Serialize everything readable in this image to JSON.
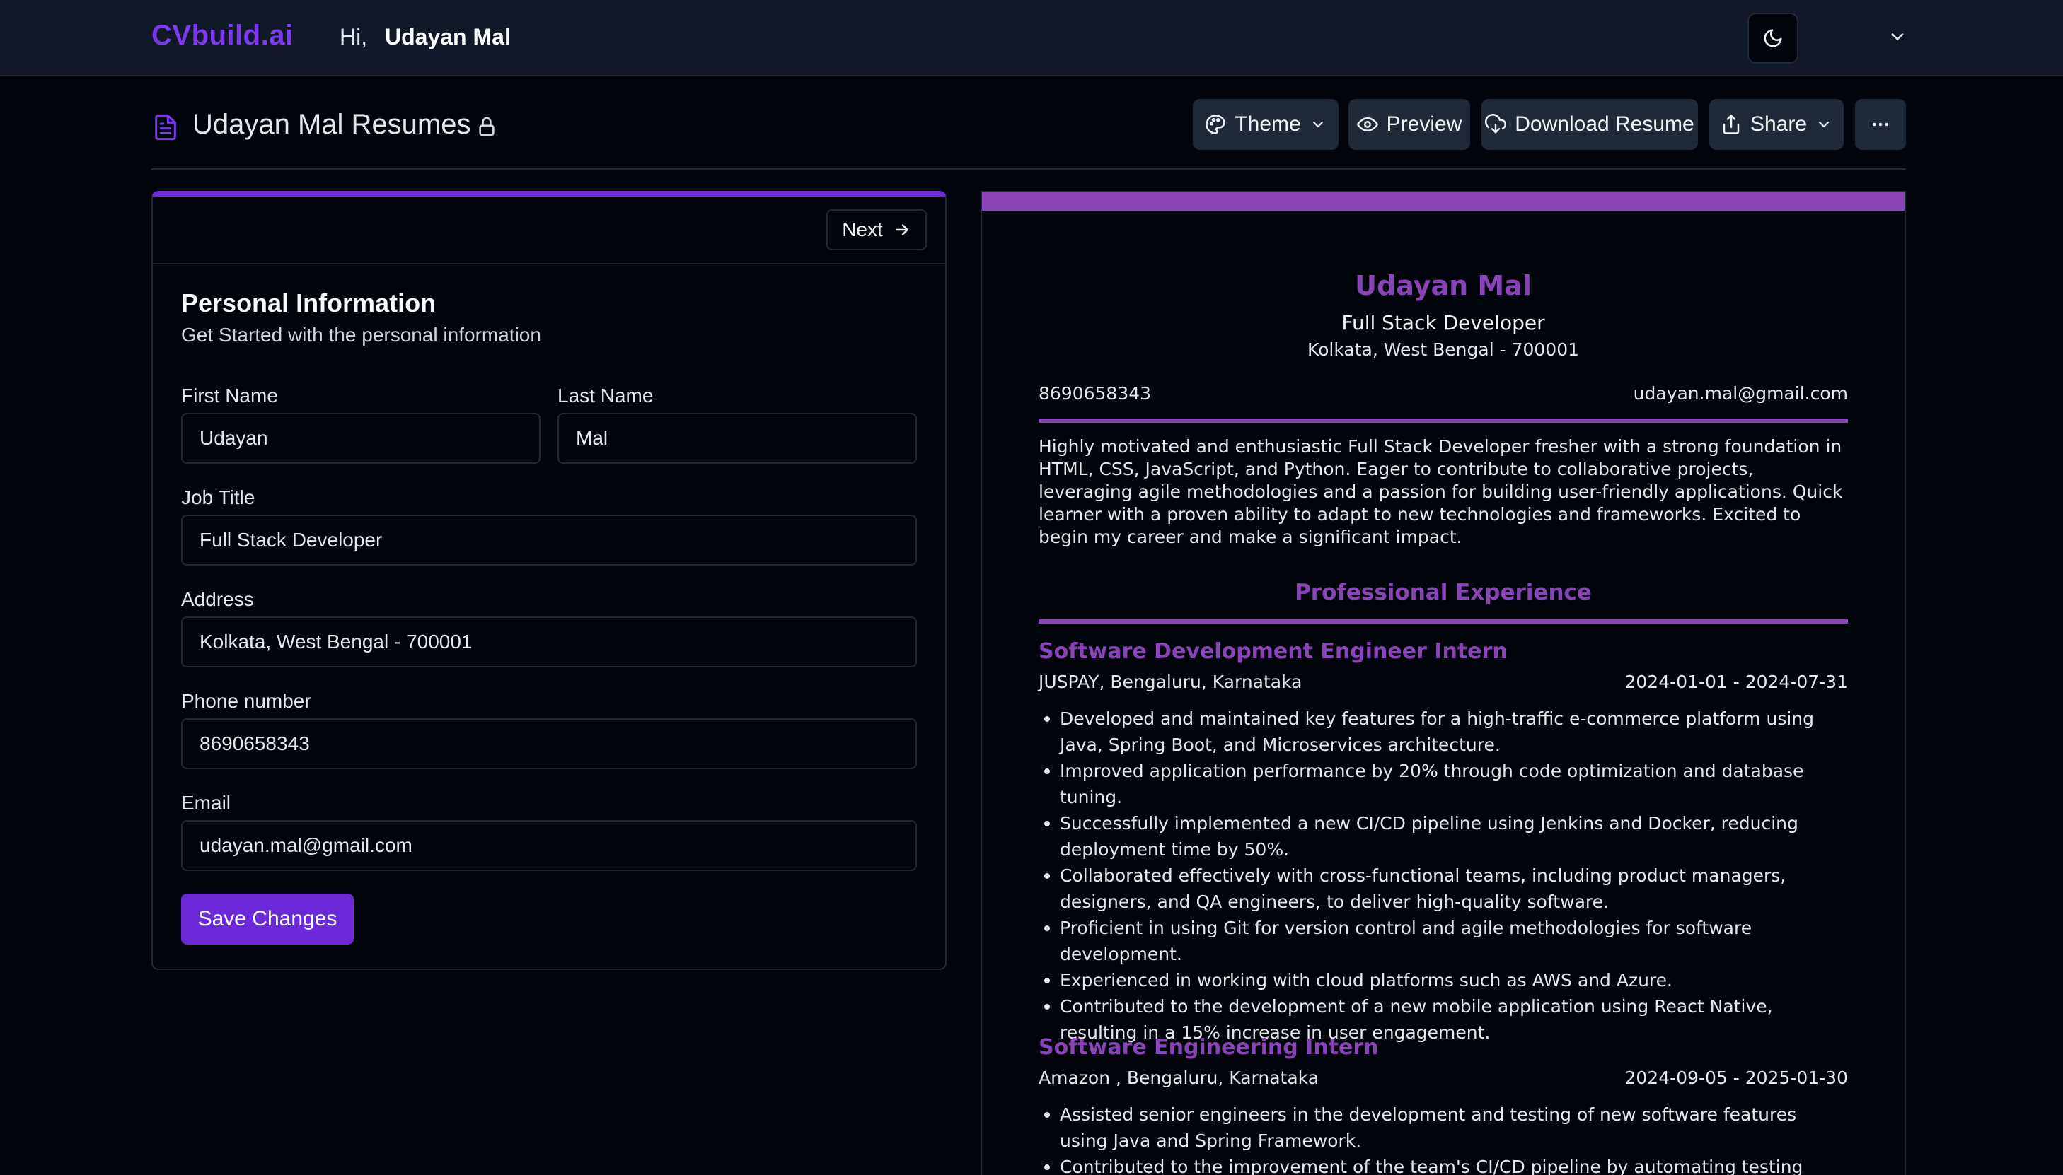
{
  "nav": {
    "brand": "CVbuild.ai",
    "greeting": "Hi,",
    "user_name": "Udayan Mal"
  },
  "header": {
    "title": "Udayan Mal Resumes",
    "theme_label": "Theme",
    "preview_label": "Preview",
    "download_label": "Download Resume",
    "share_label": "Share"
  },
  "form": {
    "next_label": "Next",
    "section_title": "Personal Information",
    "section_subtitle": "Get Started with the personal information",
    "first_name_label": "First Name",
    "first_name_value": "Udayan",
    "last_name_label": "Last Name",
    "last_name_value": "Mal",
    "job_title_label": "Job Title",
    "job_title_value": "Full Stack Developer",
    "address_label": "Address",
    "address_value": "Kolkata, West Bengal - 700001",
    "phone_label": "Phone number",
    "phone_value": "8690658343",
    "email_label": "Email",
    "email_value": "udayan.mal@gmail.com",
    "save_label": "Save Changes"
  },
  "resume": {
    "name": "Udayan Mal",
    "title": "Full Stack Developer",
    "address": "Kolkata, West Bengal - 700001",
    "phone": "8690658343",
    "email": "udayan.mal@gmail.com",
    "summary": "Highly motivated and enthusiastic Full Stack Developer fresher with a strong foundation in HTML, CSS, JavaScript, and Python. Eager to contribute to collaborative projects, leveraging agile methodologies and a passion for building user-friendly applications. Quick learner with a proven ability to adapt to new technologies and frameworks. Excited to begin my career and make a significant impact.",
    "experience_heading": "Professional Experience",
    "jobs": [
      {
        "title": "Software Development Engineer Intern",
        "company": "JUSPAY, Bengaluru, Karnataka",
        "dates": "2024-01-01 - 2024-07-31",
        "bullets": [
          "Developed and maintained key features for a high-traffic e-commerce platform using Java, Spring Boot, and Microservices architecture.",
          "Improved application performance by 20% through code optimization and database tuning.",
          "Successfully implemented a new CI/CD pipeline using Jenkins and Docker, reducing deployment time by 50%.",
          "Collaborated effectively with cross-functional teams, including product managers, designers, and QA engineers, to deliver high-quality software.",
          "Proficient in using Git for version control and agile methodologies for software development.",
          "Experienced in working with cloud platforms such as AWS and Azure.",
          "Contributed to the development of a new mobile application using React Native, resulting in a 15% increase in user engagement."
        ]
      },
      {
        "title": "Software Engineering Intern",
        "company": "Amazon , Bengaluru, Karnataka",
        "dates": "2024-09-05 - 2025-01-30",
        "bullets": [
          "Assisted senior engineers in the development and testing of new software features using Java and Spring Framework.",
          "Contributed to the improvement of the team's CI/CD pipeline by automating testing"
        ]
      }
    ]
  }
}
